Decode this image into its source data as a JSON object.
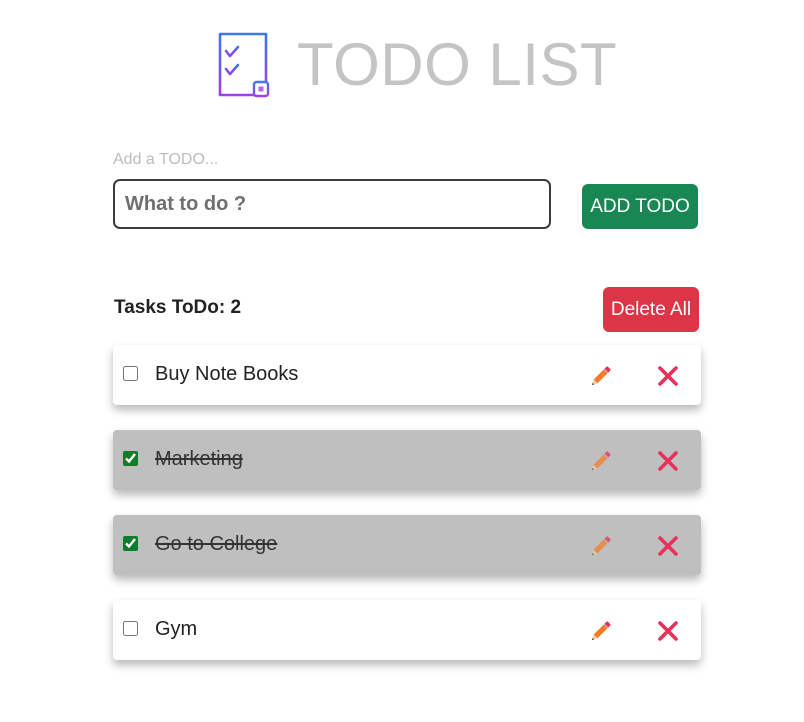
{
  "app": {
    "title": "TODO LIST",
    "logo_icon": "checklist-icon"
  },
  "form": {
    "label": "Add a TODO...",
    "input_placeholder": "What to do ?",
    "input_value": "",
    "add_button_label": "ADD TODO"
  },
  "summary": {
    "tasks_label": "Tasks ToDo: 2",
    "delete_all_label": "Delete All"
  },
  "todos": [
    {
      "text": "Buy Note Books",
      "completed": false
    },
    {
      "text": "Marketing",
      "completed": true
    },
    {
      "text": "Go to College",
      "completed": true
    },
    {
      "text": "Gym",
      "completed": false
    }
  ],
  "icons": {
    "edit": "pencil-icon",
    "delete": "close-icon"
  },
  "colors": {
    "add_button": "#198754",
    "delete_all_button": "#dc3545",
    "completed_item_bg": "#bfbfbf",
    "delete_icon": "#e8315a",
    "edit_icon": "#f47b2a",
    "title_text": "#c4c4c4"
  }
}
